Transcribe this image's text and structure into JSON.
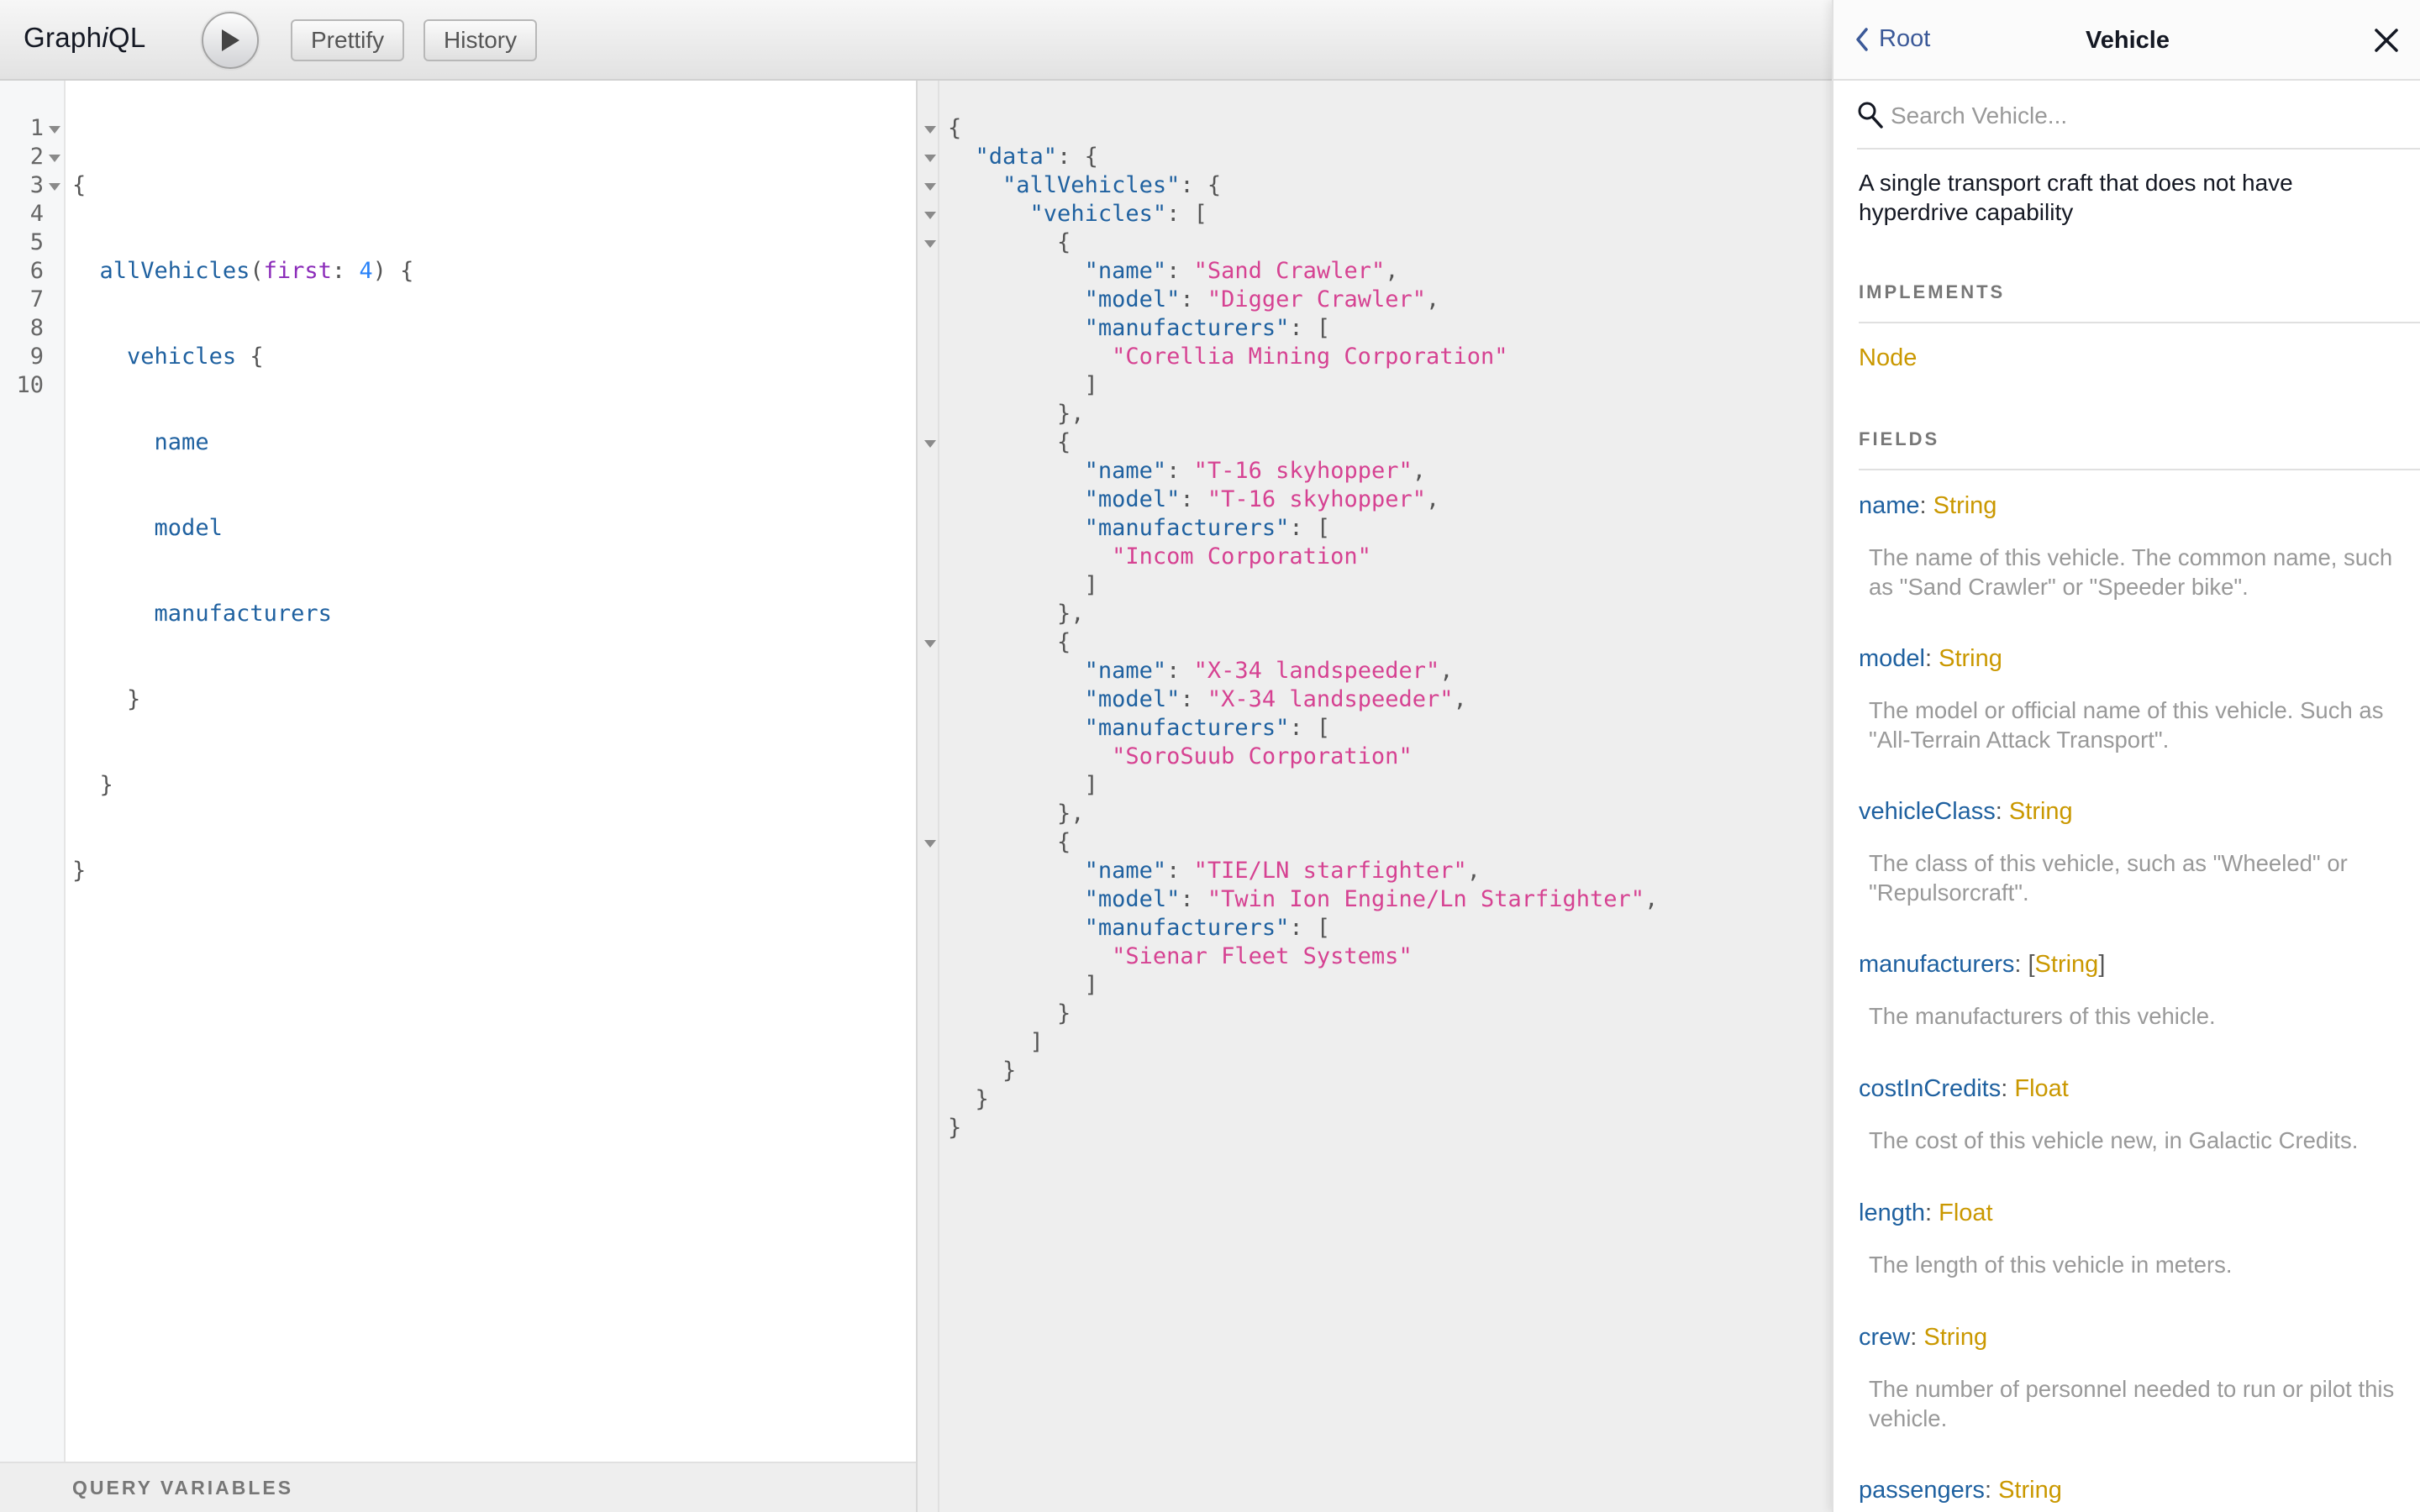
{
  "app": {
    "logo_prefix": "Graph",
    "logo_italic": "i",
    "logo_suffix": "QL",
    "buttons": {
      "prettify": "Prettify",
      "history": "History"
    }
  },
  "query": {
    "line_numbers": [
      "1",
      "2",
      "3",
      "4",
      "5",
      "6",
      "7",
      "8",
      "9",
      "10"
    ],
    "tokens": {
      "open_brace": "{",
      "all_vehicles": "allVehicles",
      "paren_open": "(",
      "arg_name": "first",
      "colon": ": ",
      "arg_value": "4",
      "paren_close_brace": ") {",
      "vehicles": "vehicles",
      "vehicles_brace": " {",
      "name": "name",
      "model": "model",
      "manufacturers": "manufacturers",
      "close_brace": "}"
    },
    "variables_label": "QUERY VARIABLES"
  },
  "result": {
    "lines": [
      "{",
      "  \"data\": {",
      "    \"allVehicles\": {",
      "      \"vehicles\": [",
      "        {",
      "          \"name\": \"Sand Crawler\",",
      "          \"model\": \"Digger Crawler\",",
      "          \"manufacturers\": [",
      "            \"Corellia Mining Corporation\"",
      "          ]",
      "        },",
      "        {",
      "          \"name\": \"T-16 skyhopper\",",
      "          \"model\": \"T-16 skyhopper\",",
      "          \"manufacturers\": [",
      "            \"Incom Corporation\"",
      "          ]",
      "        },",
      "        {",
      "          \"name\": \"X-34 landspeeder\",",
      "          \"model\": \"X-34 landspeeder\",",
      "          \"manufacturers\": [",
      "            \"SoroSuub Corporation\"",
      "          ]",
      "        },",
      "        {",
      "          \"name\": \"TIE/LN starfighter\",",
      "          \"model\": \"Twin Ion Engine/Ln Starfighter\",",
      "          \"manufacturers\": [",
      "            \"Sienar Fleet Systems\"",
      "          ]",
      "        }",
      "      ]",
      "    }",
      "  }",
      "}"
    ]
  },
  "docs": {
    "back_label": "Root",
    "title": "Vehicle",
    "search_placeholder": "Search Vehicle...",
    "description": "A single transport craft that does not have hyperdrive capability",
    "implements_title": "IMPLEMENTS",
    "implements": "Node",
    "fields_title": "FIELDS",
    "fields": [
      {
        "name": "name",
        "type_open": "",
        "type": "String",
        "type_close": "",
        "description": "The name of this vehicle. The common name, such as \"Sand Crawler\" or \"Speeder bike\"."
      },
      {
        "name": "model",
        "type_open": "",
        "type": "String",
        "type_close": "",
        "description": "The model or official name of this vehicle. Such as \"All-Terrain Attack Transport\"."
      },
      {
        "name": "vehicleClass",
        "type_open": "",
        "type": "String",
        "type_close": "",
        "description": "The class of this vehicle, such as \"Wheeled\" or \"Repulsorcraft\"."
      },
      {
        "name": "manufacturers",
        "type_open": "[",
        "type": "String",
        "type_close": "]",
        "description": "The manufacturers of this vehicle."
      },
      {
        "name": "costInCredits",
        "type_open": "",
        "type": "Float",
        "type_close": "",
        "description": "The cost of this vehicle new, in Galactic Credits."
      },
      {
        "name": "length",
        "type_open": "",
        "type": "Float",
        "type_close": "",
        "description": "The length of this vehicle in meters."
      },
      {
        "name": "crew",
        "type_open": "",
        "type": "String",
        "type_close": "",
        "description": "The number of personnel needed to run or pilot this vehicle."
      },
      {
        "name": "passengers",
        "type_open": "",
        "type": "String",
        "type_close": "",
        "description": ""
      }
    ]
  }
}
